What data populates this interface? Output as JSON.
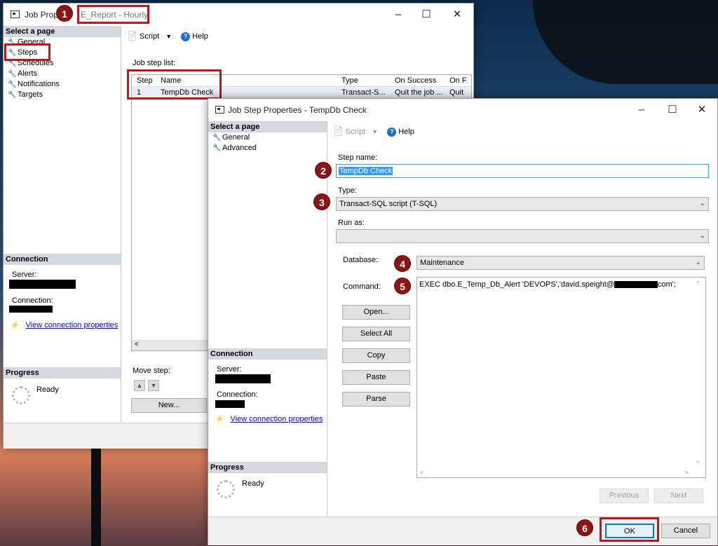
{
  "outer": {
    "title_prefix": "Job Prop",
    "title_highlight": "E_Report - Hourly",
    "nav_heading": "Select a page",
    "nav_items": [
      "General",
      "Steps",
      "Schedules",
      "Alerts",
      "Notifications",
      "Targets"
    ],
    "toolbar": {
      "script": "Script",
      "help": "Help"
    },
    "list_label": "Job step list:",
    "columns": [
      "Step",
      "Name",
      "Type",
      "On Success",
      "On F"
    ],
    "row": [
      "1",
      "TempDb Check",
      "Transact-S...",
      "Quit the job ...",
      "Quit"
    ],
    "connection_heading": "Connection",
    "server_label": "Server:",
    "connection_label": "Connection:",
    "view_conn": "View connection properties",
    "progress_heading": "Progress",
    "progress_status": "Ready",
    "move_step": "Move step:",
    "new_button": "New..."
  },
  "inner": {
    "title": "Job Step Properties - TempDb Check",
    "nav_heading": "Select a page",
    "nav_items": [
      "General",
      "Advanced"
    ],
    "toolbar": {
      "script": "Script",
      "help": "Help"
    },
    "step_name_label": "Step name:",
    "step_name": "TempDb Check",
    "type_label": "Type:",
    "type_value": "Transact-SQL script (T-SQL)",
    "run_as_label": "Run as:",
    "run_as_value": "",
    "database_label": "Database:",
    "database_value": "Maintenance",
    "command_label": "Command:",
    "command_prefix": "EXEC dbo.E_Temp_Db_Alert 'DEVOPS','david.speight@",
    "command_suffix": "com';",
    "buttons": {
      "open": "Open...",
      "select_all": "Select All",
      "copy": "Copy",
      "paste": "Paste",
      "parse": "Parse"
    },
    "connection_heading": "Connection",
    "server_label": "Server:",
    "connection_label": "Connection:",
    "view_conn": "View connection properties",
    "progress_heading": "Progress",
    "progress_status": "Ready",
    "previous": "Previous",
    "next": "Next",
    "ok": "OK",
    "cancel": "Cancel"
  },
  "badges": [
    "1",
    "2",
    "3",
    "4",
    "5",
    "6"
  ],
  "colors": {
    "accent": "#c0161b",
    "badge": "#8b1414",
    "selection": "#3399ff",
    "link": "#0000ee"
  }
}
